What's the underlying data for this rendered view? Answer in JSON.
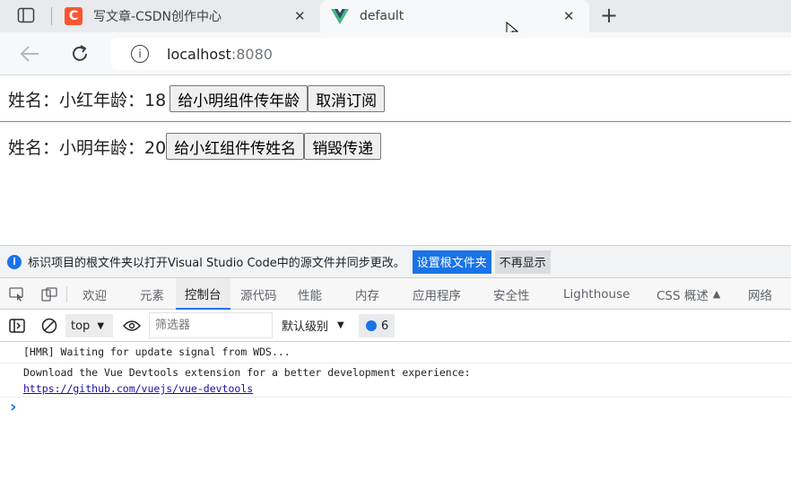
{
  "browser": {
    "tabs": [
      {
        "title": "写文章-CSDN创作中心",
        "favicon": "csdn-icon",
        "color": "#fc5531"
      },
      {
        "title": "default",
        "favicon": "vue-icon",
        "color": "#41b883"
      }
    ],
    "url": {
      "host": "localhost",
      "port": ":8080"
    }
  },
  "page": {
    "row1": {
      "text": "姓名：小红年龄：18",
      "button1": "给小明组件传年龄",
      "button2": "取消订阅"
    },
    "row2": {
      "text": "姓名：小明年龄：20",
      "button1": "给小红组件传姓名",
      "button2": "销毁传递"
    }
  },
  "devtools": {
    "notice": {
      "text": "标识项目的根文件夹以打开Visual Studio Code中的源文件并同步更改。",
      "primary_button": "设置根文件夹",
      "secondary_button": "不再显示"
    },
    "tabs": [
      "欢迎",
      "元素",
      "控制台",
      "源代码",
      "性能",
      "内存",
      "应用程序",
      "安全性",
      "Lighthouse",
      "CSS 概述",
      "网络"
    ],
    "active_tab": "控制台",
    "toolbar": {
      "context": "top",
      "filter_placeholder": "筛选器",
      "level": "默认级别",
      "message_count": "6"
    },
    "console": {
      "line1": "[HMR] Waiting for update signal from WDS...",
      "line2": "Download the Vue Devtools extension for a better development experience:",
      "link": "https://github.com/vuejs/vue-devtools",
      "prompt": "›"
    }
  }
}
